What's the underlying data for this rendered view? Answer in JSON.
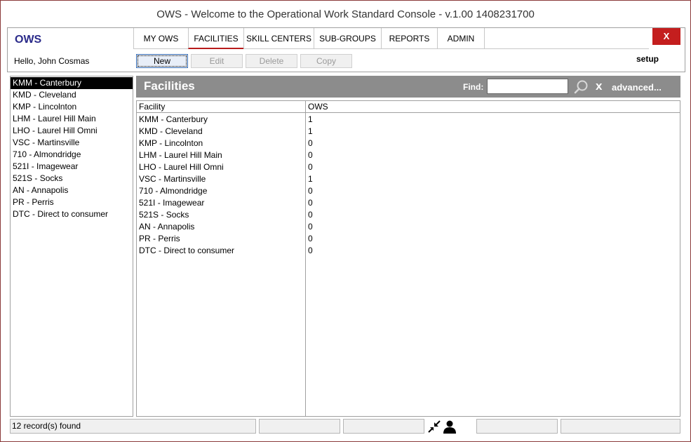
{
  "window": {
    "title": "OWS - Welcome to the Operational Work Standard Console - v.1.00 1408231700"
  },
  "app": {
    "name": "OWS",
    "close_label": "X",
    "setup_label": "setup"
  },
  "user": {
    "greeting": "Hello, John Cosmas"
  },
  "nav": {
    "tabs": [
      {
        "label": "MY OWS"
      },
      {
        "label": "FACILITIES"
      },
      {
        "label": "SKILL CENTERS"
      },
      {
        "label": "SUB-GROUPS"
      },
      {
        "label": "REPORTS"
      },
      {
        "label": "ADMIN"
      }
    ],
    "active_tab": "FACILITIES"
  },
  "toolbar": {
    "new_label": "New",
    "edit_label": "Edit",
    "delete_label": "Delete",
    "copy_label": "Copy"
  },
  "sidebar": {
    "items": [
      "KMM - Canterbury",
      "KMD - Cleveland",
      "KMP - Lincolnton",
      "LHM - Laurel Hill Main",
      "LHO - Laurel Hill Omni",
      "VSC - Martinsville",
      "710 - Almondridge",
      "521I - Imagewear",
      "521S - Socks",
      "AN - Annapolis",
      "PR - Perris",
      "DTC - Direct to consumer"
    ],
    "selected_index": 0
  },
  "panel": {
    "title": "Facilities",
    "find_label": "Find:",
    "find_value": "",
    "clear_label": "x",
    "advanced_label": "advanced..."
  },
  "table": {
    "columns": [
      "Facility",
      "OWS"
    ],
    "rows": [
      [
        "KMM - Canterbury",
        "1"
      ],
      [
        "KMD - Cleveland",
        "1"
      ],
      [
        "KMP - Lincolnton",
        "0"
      ],
      [
        "LHM - Laurel Hill Main",
        "0"
      ],
      [
        "LHO - Laurel Hill Omni",
        "0"
      ],
      [
        "VSC - Martinsville",
        "1"
      ],
      [
        "710 - Almondridge",
        "0"
      ],
      [
        "521I - Imagewear",
        "0"
      ],
      [
        "521S - Socks",
        "0"
      ],
      [
        "AN - Annapolis",
        "0"
      ],
      [
        "PR - Perris",
        "0"
      ],
      [
        "DTC - Direct to consumer",
        "0"
      ]
    ]
  },
  "status": {
    "records_text": "12 record(s) found"
  },
  "colors": {
    "brand": "#2b2b8a",
    "accent_red": "#c41e1e",
    "header_gray": "#8c8c8c",
    "window_border": "#8b3a3a"
  },
  "icons": {
    "status_left": "collapse-arrows-icon",
    "status_right": "user-icon",
    "search": "search-icon"
  }
}
